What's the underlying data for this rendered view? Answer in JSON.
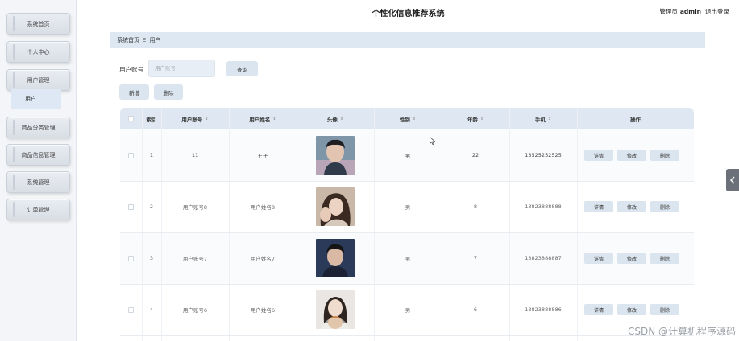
{
  "header": {
    "title": "个性化信息推荐系统",
    "role": "管理员",
    "username": "admin",
    "logout": "退出登录"
  },
  "sidebar": {
    "items": [
      {
        "label": "系统首页"
      },
      {
        "label": "个人中心"
      },
      {
        "label": "用户管理"
      },
      {
        "label": "商品分类管理"
      },
      {
        "label": "商品信息管理"
      },
      {
        "label": "系统管理"
      },
      {
        "label": "订单管理"
      }
    ],
    "submenu": {
      "label": "用户"
    }
  },
  "breadcrumb": {
    "home": "系统首页",
    "separator": "Ξ",
    "current": "用户"
  },
  "search": {
    "label": "用户账号",
    "placeholder": "用户账号",
    "value": ""
  },
  "buttons": {
    "query": "查询",
    "add": "新增",
    "delete": "删除"
  },
  "table": {
    "columns": [
      {
        "label": ""
      },
      {
        "label": "索引",
        "sortable": false
      },
      {
        "label": "用户账号",
        "sortable": true
      },
      {
        "label": "用户姓名",
        "sortable": true
      },
      {
        "label": "头像",
        "sortable": true
      },
      {
        "label": "性别",
        "sortable": true
      },
      {
        "label": "年龄",
        "sortable": true
      },
      {
        "label": "手机",
        "sortable": true
      },
      {
        "label": "操作",
        "sortable": false
      }
    ],
    "sort_icon": "⇕",
    "rows": [
      {
        "index": "1",
        "account": "11",
        "name": "王子",
        "gender": "男",
        "age": "22",
        "phone": "13525252525",
        "avatar": "avatar-man-1"
      },
      {
        "index": "2",
        "account": "用户账号8",
        "name": "用户姓名8",
        "gender": "男",
        "age": "8",
        "phone": "13823888888",
        "avatar": "avatar-woman-1"
      },
      {
        "index": "3",
        "account": "用户账号7",
        "name": "用户姓名7",
        "gender": "男",
        "age": "7",
        "phone": "13823888887",
        "avatar": "avatar-man-2"
      },
      {
        "index": "4",
        "account": "用户账号6",
        "name": "用户姓名6",
        "gender": "男",
        "age": "6",
        "phone": "13823888886",
        "avatar": "avatar-woman-2"
      }
    ],
    "actions": {
      "detail": "详情",
      "edit": "修改",
      "delete": "删除"
    }
  },
  "right_tab_icon": "chevron-left-icon",
  "watermark": "CSDN @计算机程序源码"
}
